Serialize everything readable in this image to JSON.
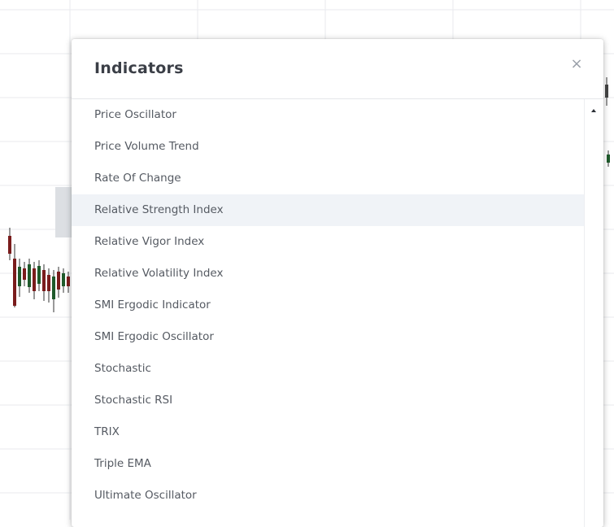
{
  "dialog": {
    "title": "Indicators",
    "close_label": "×",
    "items": [
      {
        "label": "Price Oscillator"
      },
      {
        "label": "Price Volume Trend"
      },
      {
        "label": "Rate Of Change"
      },
      {
        "label": "Relative Strength Index",
        "hovered": true
      },
      {
        "label": "Relative Vigor Index"
      },
      {
        "label": "Relative Volatility Index"
      },
      {
        "label": "SMI Ergodic Indicator"
      },
      {
        "label": "SMI Ergodic Oscillator"
      },
      {
        "label": "Stochastic"
      },
      {
        "label": "Stochastic RSI"
      },
      {
        "label": "TRIX"
      },
      {
        "label": "Triple EMA"
      },
      {
        "label": "Ultimate Oscillator"
      }
    ]
  },
  "icons": {
    "close": "close-icon",
    "scroll_up": "scroll-up-arrow-icon"
  },
  "colors": {
    "hover_background": "#f0f3f7",
    "grid_line": "#e8eaed",
    "candle_red": "#7a1c1c",
    "candle_green": "#1f5a2b"
  }
}
